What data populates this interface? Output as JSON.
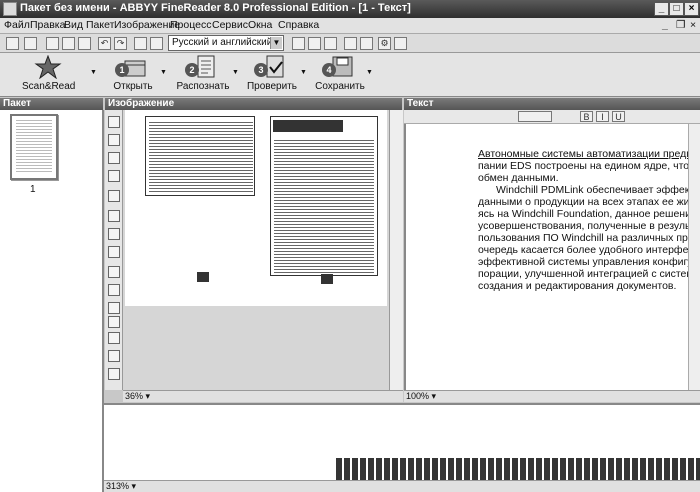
{
  "window": {
    "title": "Пакет без имени - ABBYY FineReader 8.0 Professional Edition - [1 - Текст]"
  },
  "menu": [
    "Файл",
    "Правка",
    "Вид",
    "Пакет",
    "Изображение",
    "Процесс",
    "Сервис",
    "Окна",
    "Справка"
  ],
  "toolbar": {
    "language": "Русский и английский"
  },
  "big_buttons": [
    {
      "label": "Scan&Read",
      "num": ""
    },
    {
      "label": "Открыть",
      "num": "1"
    },
    {
      "label": "Распознать",
      "num": "2"
    },
    {
      "label": "Проверить",
      "num": "3"
    },
    {
      "label": "Сохранить",
      "num": "4"
    }
  ],
  "panes": {
    "batch": "Пакет",
    "image": "Изображение",
    "text": "Текст"
  },
  "batch": {
    "page_number": "1"
  },
  "image_view": {
    "zoom": "36%"
  },
  "text_view": {
    "zoom": "100%",
    "lines": [
      "Автономные системы автоматизации предприятия",
      "пании EDS построены на едином ядре, что обеспе",
      "обмен данными.",
      "Windchill PDMLink обеспечивает эффективное",
      "данными о продукции на всех этапах ее жизненно",
      "ясь на Windchill Foundation, данное решение включ",
      "усовершенствования, полученные в результате п",
      "пользования ПО Windchill на различных предприят",
      "очередь касается более удобного интерфейса пол",
      "эффективной системы управления конфигурациям",
      "порации, улучшенной интеграцией с системами CA",
      "создания и редактирования документов."
    ]
  },
  "zoom_view": {
    "zoom": "313%"
  }
}
